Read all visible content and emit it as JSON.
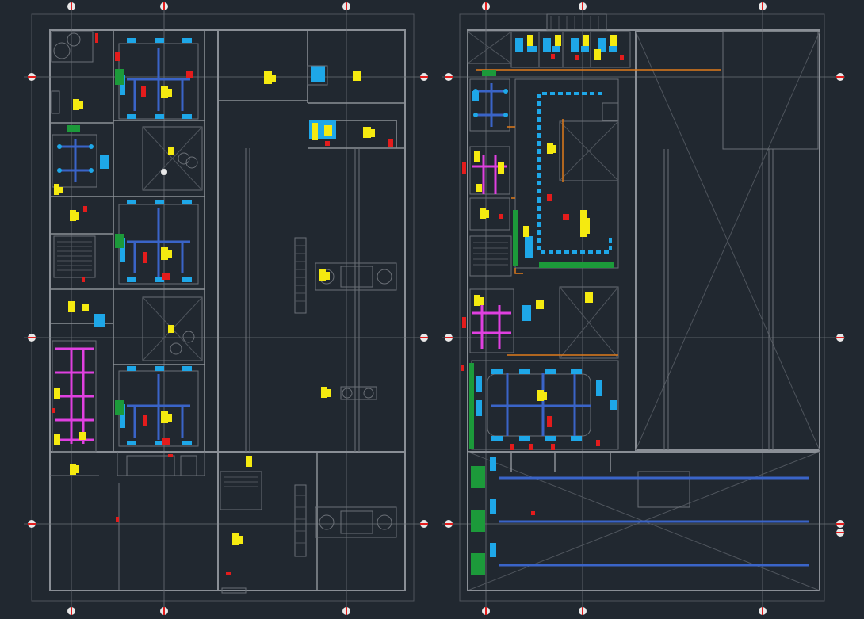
{
  "canvas": {
    "background": "#212830"
  },
  "colors": {
    "wall": "#8a8f96",
    "duct_blue": "#1ea7e8",
    "fixture_yellow": "#f5ea10",
    "diffuser_red": "#e41c1c",
    "unit_green": "#1c9a3a",
    "pipe_magenta": "#e040e0",
    "pipe_orange": "#e07a1a",
    "axis_marker": "#e8e8e8"
  },
  "sheets": [
    {
      "id": "left-floor-plan"
    },
    {
      "id": "right-hvac-plan"
    }
  ],
  "icons": [
    "grid-axis-marker-icon",
    "fan-icon",
    "forklift-truck-icon",
    "tractor-icon",
    "stair-icon",
    "north-arrow-icon"
  ]
}
